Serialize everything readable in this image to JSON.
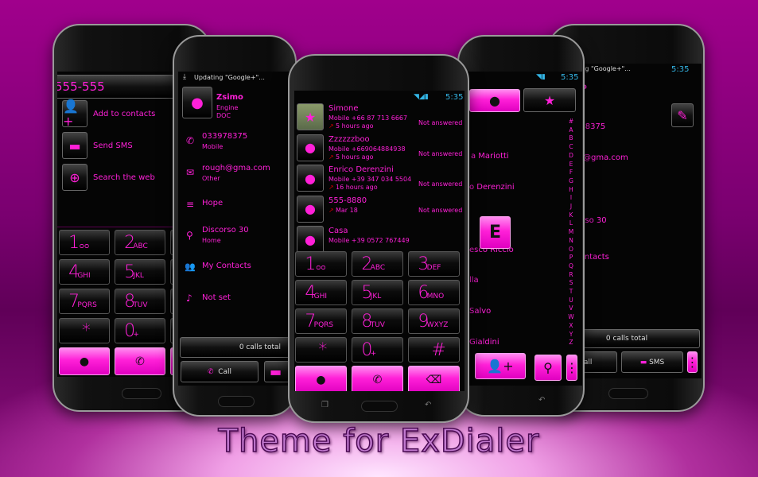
{
  "title": "Theme for ExDialer",
  "colors": {
    "accent": "#ff20d8",
    "background": "#7a0070"
  },
  "status": {
    "time": "5:35",
    "notification": "Updating \"Google+\"..."
  },
  "dialpad": {
    "keys": [
      {
        "n": "1",
        "l": "ᴑᴑ"
      },
      {
        "n": "2",
        "l": "ABC"
      },
      {
        "n": "3",
        "l": "DEF"
      },
      {
        "n": "4",
        "l": "GHI"
      },
      {
        "n": "5",
        "l": "JKL"
      },
      {
        "n": "6",
        "l": "MNO"
      },
      {
        "n": "7",
        "l": "PQRS"
      },
      {
        "n": "8",
        "l": "TUV"
      },
      {
        "n": "9",
        "l": "WXYZ"
      },
      {
        "n": "*",
        "l": ""
      },
      {
        "n": "0",
        "l": "+"
      },
      {
        "n": "#",
        "l": ""
      }
    ],
    "actions": [
      "contacts-icon",
      "call-icon",
      "backspace-icon"
    ]
  },
  "search_phone": {
    "number": "555-555",
    "actions": [
      "Add to contacts",
      "Send SMS",
      "Search the web"
    ]
  },
  "contact_detail": {
    "name": "Zsimo",
    "company": "Engine",
    "title": "DOC",
    "phone": "033978375",
    "phone_type": "Mobile",
    "email": "rough@gma.com",
    "email_type": "Other",
    "note": "Hope",
    "address": "Discorso 30",
    "address_type": "Home",
    "group": "My Contacts",
    "ringtone": "Not set",
    "calls_total": "0 calls total",
    "call_label": "Call",
    "sms_label": "SMS"
  },
  "call_log": [
    {
      "name": "Simone",
      "detail": "Mobile +66 87 713 6667",
      "time": "5 hours ago",
      "status": "Not answered"
    },
    {
      "name": "Zzzzzzboo",
      "detail": "Mobile +669064884938",
      "time": "5 hours ago",
      "status": "Not answered"
    },
    {
      "name": "Enrico Derenzini",
      "detail": "Mobile +39 347 034 5504",
      "time": "16 hours ago",
      "status": "Not answered"
    },
    {
      "name": "555-8880",
      "detail": "",
      "time": "Mar 18",
      "status": "Not answered"
    },
    {
      "name": "Casa",
      "detail": "Mobile +39 0572 767449",
      "time": "",
      "status": ""
    }
  ],
  "contacts": {
    "visible_names": [
      "a Mariotti",
      "o Derenzini",
      "esco Riccio",
      "lla",
      "Salvo",
      "Gialdini"
    ],
    "popup_letter": "E",
    "index": [
      "#",
      "A",
      "B",
      "C",
      "D",
      "E",
      "F",
      "G",
      "H",
      "I",
      "J",
      "K",
      "L",
      "M",
      "N",
      "O",
      "P",
      "Q",
      "R",
      "S",
      "T",
      "U",
      "V",
      "W",
      "X",
      "Y",
      "Z"
    ]
  }
}
